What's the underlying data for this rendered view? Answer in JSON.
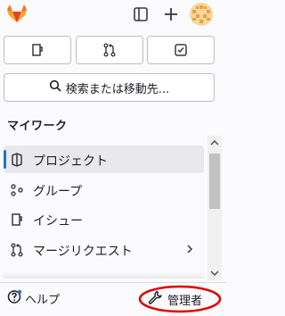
{
  "topbar": {
    "logo_icon": "gitlab-tanuki-icon",
    "toggle_icon": "sidebar-toggle-icon",
    "new_icon": "plus-icon",
    "avatar_icon": "user-avatar",
    "brand_color": "#e24329"
  },
  "shortcuts": [
    {
      "icon": "issues-icon"
    },
    {
      "icon": "merge-request-icon"
    },
    {
      "icon": "todo-checkbox-icon"
    }
  ],
  "search": {
    "label": "検索または移動先...",
    "icon": "search-icon"
  },
  "section": {
    "title": "マイワーク"
  },
  "nav": {
    "items": [
      {
        "label": "プロジェクト",
        "icon": "project-icon",
        "active": true
      },
      {
        "label": "グループ",
        "icon": "group-icon",
        "active": false
      },
      {
        "label": "イシュー",
        "icon": "issues-icon",
        "active": false
      },
      {
        "label": "マージリクエスト",
        "icon": "merge-request-icon",
        "active": false,
        "has_submenu": true
      }
    ],
    "active_color": "#1f75cb"
  },
  "footer": {
    "help_label": "ヘルプ",
    "admin_label": "管理者",
    "annotation_color": "#e00000"
  }
}
